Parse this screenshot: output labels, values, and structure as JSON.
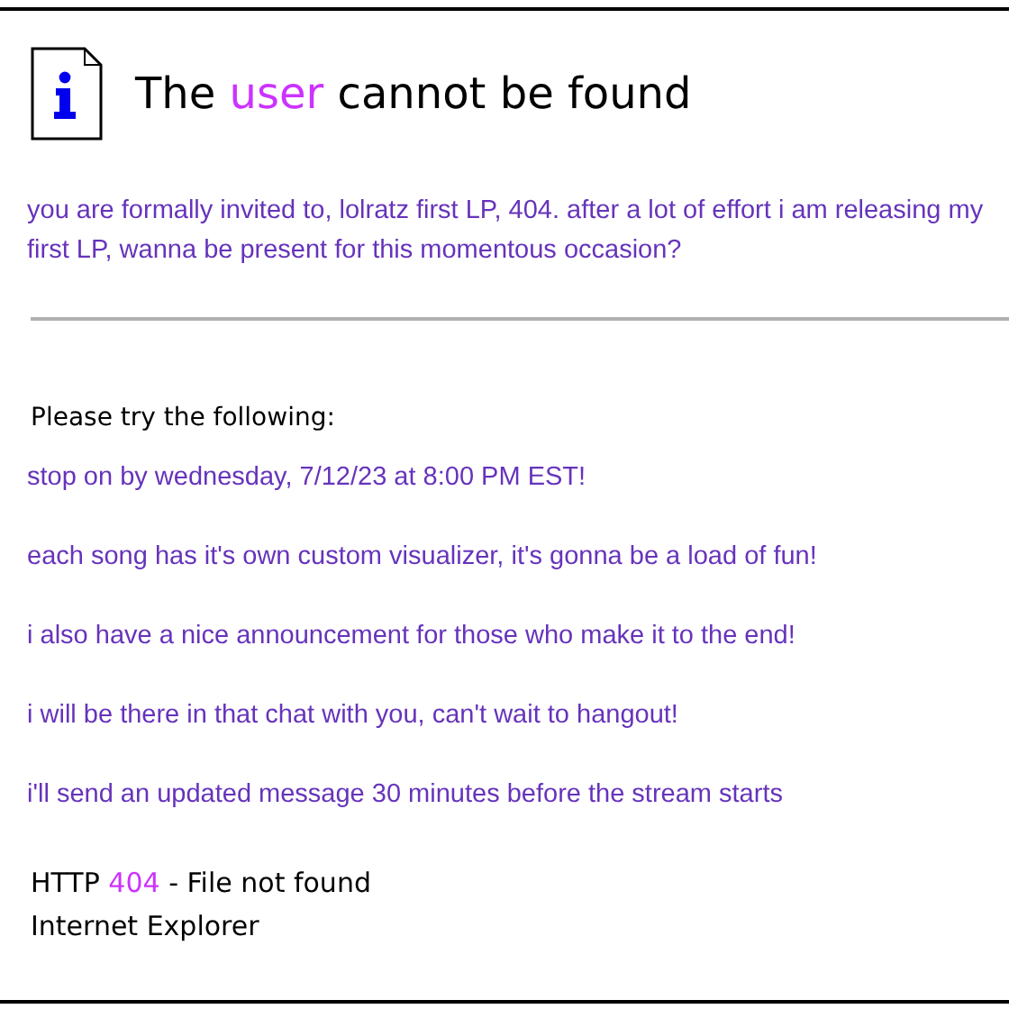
{
  "title": {
    "before": "The",
    "highlight": "user",
    "after": "cannot be found"
  },
  "message": "you are formally invited to, lolratz first LP, 404. after a lot of effort i am releasing my first LP, wanna be present for this momentous occasion?",
  "try_heading": "Please try the following:",
  "items": [
    "stop on by wednesday, 7/12/23 at 8:00 PM EST!",
    "each song has it's own custom visualizer, it's gonna be a load of fun!",
    "i also have a nice announcement for those who make it to the end!",
    "i will be there in that chat with you, can't wait to hangout!",
    "i'll send an updated message 30 minutes before the stream starts"
  ],
  "footer": {
    "prefix": "HTTP",
    "code": "404",
    "suffix": "- File not found",
    "browser": "Internet Explorer"
  }
}
